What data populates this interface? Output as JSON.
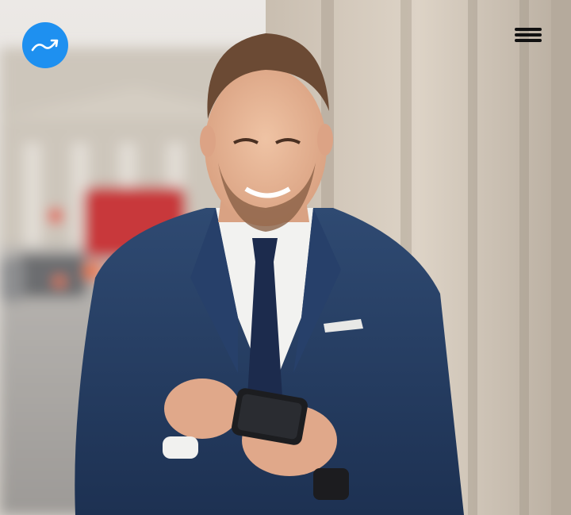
{
  "header": {
    "logo_icon": "stock-arrow-logo-icon",
    "menu_icon": "hamburger-menu-icon"
  },
  "hero": {
    "image_subject": "businessman-using-smartphone"
  },
  "colors": {
    "brand": "#1e90f0",
    "logo_glyph": "#ffffff",
    "menu_bars": "#111111"
  }
}
